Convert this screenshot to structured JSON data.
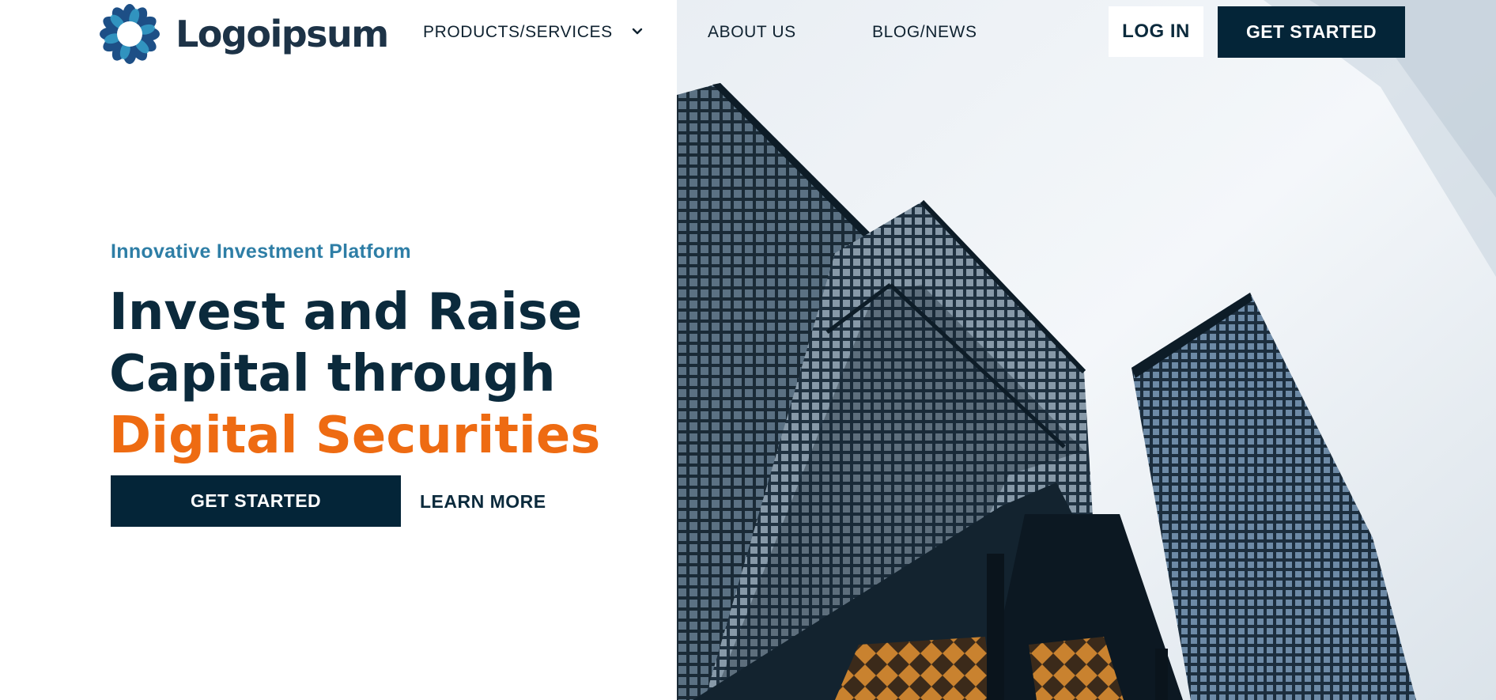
{
  "header": {
    "logo_text": "Logoipsum",
    "nav": [
      {
        "label": "PRODUCTS/SERVICES",
        "icon": "chevron-down-icon"
      },
      {
        "label": "ABOUT US"
      },
      {
        "label": "BLOG/NEWS"
      }
    ],
    "login_label": "LOG IN",
    "get_started_label": "GET STARTED"
  },
  "hero": {
    "eyebrow": "Innovative Investment Platform",
    "headline_line1": "Invest and Raise",
    "headline_line2": "Capital through",
    "headline_accent": "Digital Securities",
    "primary_cta": "GET STARTED",
    "secondary_cta": "LEARN MORE",
    "image_subject": "skyscrapers"
  },
  "colors": {
    "navy": "#042538",
    "heading": "#0b2a3c",
    "eyebrow": "#2e7ea6",
    "accent_orange": "#ee6b12",
    "logo_blue": "#2f7fb0"
  }
}
